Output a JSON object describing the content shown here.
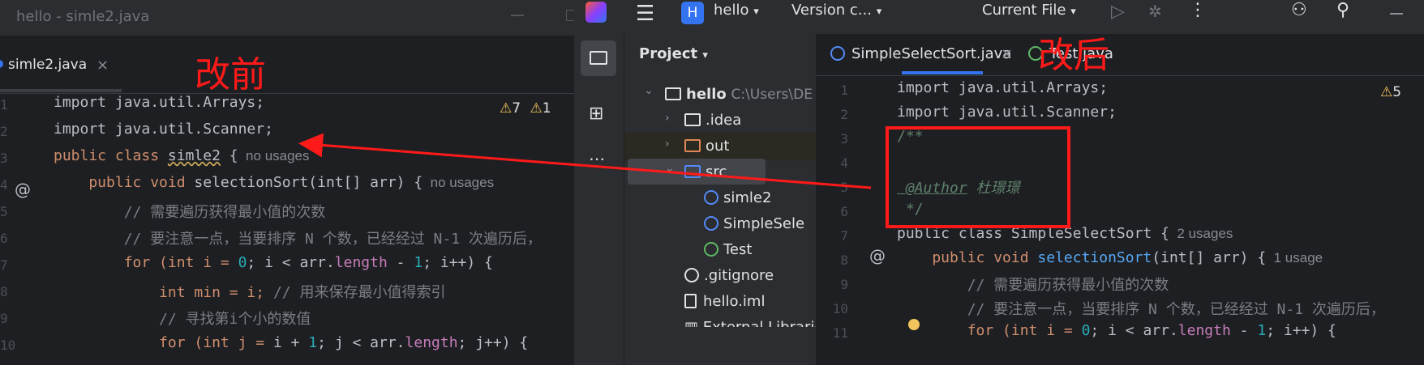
{
  "left_window": {
    "title": "hello - simle2.java",
    "tab_label": "simle2.java",
    "tab_close": "×",
    "overlay_label": "改前",
    "warnings": {
      "a": "7",
      "b": "1"
    },
    "line_numbers": [
      "1",
      "2",
      "3",
      "4",
      "5",
      "6",
      "7",
      "8",
      "9",
      "10"
    ],
    "lines": [
      "import java.util.Arrays;",
      "import java.util.Scanner;",
      [
        "public class ",
        "simle2",
        " {",
        "  no usages"
      ],
      [
        "    public void ",
        "selectionSort",
        "(int[] arr) {",
        "  no usages"
      ],
      "        // 需要遍历获得最小值的次数",
      "        // 要注意一点，当要排序 N 个数，已经经过 N-1 次遍历后，",
      [
        "        for (int i = ",
        "0",
        "; i < arr.",
        "length",
        " - ",
        "1",
        "; i++) {"
      ],
      [
        "            int min = i; ",
        "// 用来保存最小值得索引"
      ],
      "            // 寻找第i个小的数值",
      [
        "            for (int j = ",
        "i",
        " + ",
        "1",
        "; j < arr.",
        "length",
        "; j++) {"
      ]
    ]
  },
  "right_window": {
    "menu_icon": "hamburger-menu-icon",
    "project_badge": "H",
    "project_name": "hello",
    "vcs_label": "Version c...",
    "run_config": "Current File",
    "overlay_label": "改后",
    "project_panel_title": "Project",
    "tree": [
      {
        "label": "hello",
        "path": "C:\\Users\\DE",
        "icon": "module-folder-icon"
      },
      {
        "label": ".idea",
        "icon": "folder-icon"
      },
      {
        "label": "out",
        "icon": "folder-orange-icon"
      },
      {
        "label": "src",
        "icon": "source-folder-icon"
      },
      {
        "label": "simle2",
        "icon": "class-icon"
      },
      {
        "label": "SimpleSele",
        "icon": "class-icon"
      },
      {
        "label": "Test",
        "icon": "class-run-icon"
      },
      {
        "label": ".gitignore",
        "icon": "ignore-file-icon"
      },
      {
        "label": "hello.iml",
        "icon": "iml-file-icon"
      },
      {
        "label": "External Libraries",
        "icon": "library-icon"
      }
    ],
    "tabs": [
      {
        "label": "SimpleSelectSort.java",
        "close": "×"
      },
      {
        "label": "Test.java"
      }
    ],
    "warnings": "5",
    "line_numbers": [
      "1",
      "2",
      "3",
      "4",
      "5",
      "6",
      "7",
      "8",
      "9",
      "10",
      "11"
    ],
    "lines": [
      "import java.util.Arrays;",
      "import java.util.Scanner;",
      "/**",
      "",
      [
        " @Author",
        " 杜璟璟"
      ],
      " */",
      [
        "public class SimpleSelectSort {",
        "  2 usages"
      ],
      [
        "    public void ",
        "selectionSort",
        "(int[] arr) {",
        "  1 usage"
      ],
      "        // 需要遍历获得最小值的次数",
      "        // 要注意一点，当要排序 N 个数，已经经过 N-1 次遍历后，",
      [
        "        for (int i = ",
        "0",
        "; i < arr.",
        "length",
        " - ",
        "1",
        "; i++) {"
      ]
    ]
  },
  "colors": {
    "accent_red": "#ff1a1a",
    "keyword": "#cf8e6d",
    "comment": "#7a7e85",
    "number": "#2aacb8",
    "function": "#56a8f5",
    "doc": "#5f826b"
  }
}
